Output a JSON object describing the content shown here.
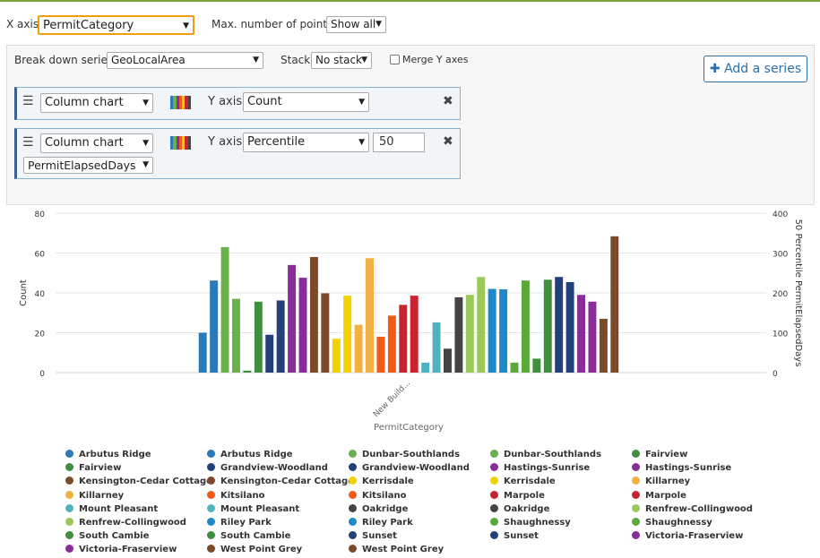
{
  "controls": {
    "x_axis_label": "X axis",
    "x_axis_value": "PermitCategory",
    "max_points_label": "Max. number of points",
    "max_points_value": "Show all",
    "breakdown_label": "Break down series",
    "breakdown_value": "GeoLocalArea",
    "stack_label": "Stack",
    "stack_value": "No stack",
    "merge_label": "Merge Y axes",
    "merge_checked": false,
    "add_series_label": "Add a series"
  },
  "series_rows": [
    {
      "chart_type": "Column chart",
      "y_axis_label": "Y axis",
      "y_value": "Count"
    },
    {
      "chart_type": "Column chart",
      "y_axis_label": "Y axis",
      "y_value": "Percentile",
      "percentile": "50",
      "field": "PermitElapsedDays"
    }
  ],
  "chart_data": {
    "type": "bar",
    "categories": [
      "New Build..."
    ],
    "xlabel": "PermitCategory",
    "ylabel_left": "Count",
    "ylabel_right": "50 Percentile PermitElapsedDays",
    "ylim_left": [
      0,
      80
    ],
    "ylim_right": [
      0,
      400
    ],
    "yticks_left": [
      "0",
      "20",
      "40",
      "60",
      "80"
    ],
    "yticks_right": [
      "0",
      "100",
      "200",
      "300",
      "400"
    ],
    "grid": true,
    "series": [
      {
        "name": "Arbutus Ridge",
        "axis": "left",
        "value": 20,
        "color": "#2a7ab9"
      },
      {
        "name": "Arbutus Ridge",
        "axis": "right",
        "value": 231,
        "color": "#2a7ab9"
      },
      {
        "name": "Dunbar-Southlands",
        "axis": "left",
        "value": 63,
        "color": "#6ab04c"
      },
      {
        "name": "Dunbar-Southlands",
        "axis": "right",
        "value": 185,
        "color": "#6ab04c"
      },
      {
        "name": "Fairview",
        "axis": "left",
        "value": 1,
        "color": "#3f8f3f"
      },
      {
        "name": "Fairview",
        "axis": "right",
        "value": 178,
        "color": "#3f8f3f"
      },
      {
        "name": "Grandview-Woodland",
        "axis": "left",
        "value": 19,
        "color": "#23407a"
      },
      {
        "name": "Grandview-Woodland",
        "axis": "right",
        "value": 181,
        "color": "#23407a"
      },
      {
        "name": "Hastings-Sunrise",
        "axis": "left",
        "value": 54,
        "color": "#8a2d9a"
      },
      {
        "name": "Hastings-Sunrise",
        "axis": "right",
        "value": 238,
        "color": "#8a2d9a"
      },
      {
        "name": "Kensington-Cedar Cottage",
        "axis": "left",
        "value": 58,
        "color": "#7b4a2a"
      },
      {
        "name": "Kensington-Cedar Cottage",
        "axis": "right",
        "value": 199,
        "color": "#7b4a2a"
      },
      {
        "name": "Kerrisdale",
        "axis": "left",
        "value": 17,
        "color": "#f2d100"
      },
      {
        "name": "Kerrisdale",
        "axis": "right",
        "value": 193,
        "color": "#f2d100"
      },
      {
        "name": "Killarney",
        "axis": "left",
        "value": 24,
        "color": "#f4b042"
      },
      {
        "name": "Killarney",
        "axis": "right",
        "value": 287,
        "color": "#f4b042"
      },
      {
        "name": "Kitsilano",
        "axis": "left",
        "value": 18,
        "color": "#f45a13"
      },
      {
        "name": "Kitsilano",
        "axis": "right",
        "value": 143,
        "color": "#f45a13"
      },
      {
        "name": "Marpole",
        "axis": "left",
        "value": 34,
        "color": "#c8242f"
      },
      {
        "name": "Marpole",
        "axis": "right",
        "value": 193,
        "color": "#c8242f"
      },
      {
        "name": "Mount Pleasant",
        "axis": "left",
        "value": 5,
        "color": "#4fb3bf"
      },
      {
        "name": "Mount Pleasant",
        "axis": "right",
        "value": 126,
        "color": "#4fb3bf"
      },
      {
        "name": "Oakridge",
        "axis": "left",
        "value": 12,
        "color": "#444444"
      },
      {
        "name": "Oakridge",
        "axis": "right",
        "value": 189,
        "color": "#444444"
      },
      {
        "name": "Renfrew-Collingwood",
        "axis": "left",
        "value": 39,
        "color": "#9ac95a"
      },
      {
        "name": "Renfrew-Collingwood",
        "axis": "right",
        "value": 240,
        "color": "#9ac95a"
      },
      {
        "name": "Riley Park",
        "axis": "left",
        "value": 42,
        "color": "#1d8ac9"
      },
      {
        "name": "Riley Park",
        "axis": "right",
        "value": 209,
        "color": "#1d8ac9"
      },
      {
        "name": "Shaughnessy",
        "axis": "left",
        "value": 5,
        "color": "#5aaa3a"
      },
      {
        "name": "Shaughnessy",
        "axis": "right",
        "value": 231,
        "color": "#5aaa3a"
      },
      {
        "name": "South Cambie",
        "axis": "left",
        "value": 7,
        "color": "#3f8f3f"
      },
      {
        "name": "South Cambie",
        "axis": "right",
        "value": 233,
        "color": "#3f8f3f"
      },
      {
        "name": "Sunset",
        "axis": "left",
        "value": 48,
        "color": "#23407a"
      },
      {
        "name": "Sunset",
        "axis": "right",
        "value": 227,
        "color": "#23407a"
      },
      {
        "name": "Victoria-Fraserview",
        "axis": "left",
        "value": 39,
        "color": "#8a2d9a"
      },
      {
        "name": "Victoria-Fraserview",
        "axis": "right",
        "value": 178,
        "color": "#8a2d9a"
      },
      {
        "name": "West Point Grey",
        "axis": "left",
        "value": 27,
        "color": "#7b4a2a"
      },
      {
        "name": "West Point Grey",
        "axis": "right",
        "value": 342,
        "color": "#7b4a2a"
      }
    ]
  },
  "palette_colors": [
    "#2a7ab9",
    "#6ab04c",
    "#3f8f3f",
    "#8a2d9a",
    "#7b4a2a",
    "#f2d100",
    "#c8242f",
    "#444444"
  ]
}
